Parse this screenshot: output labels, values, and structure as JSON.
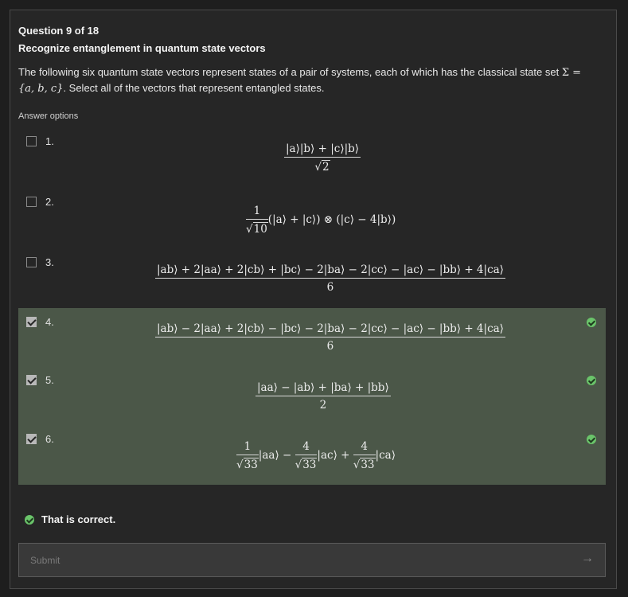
{
  "question": {
    "number_label": "Question 9 of 18",
    "title": "Recognize entanglement in quantum state vectors",
    "text_before_math": "The following six quantum state vectors represent states of a pair of systems, each of which has the classical state set ",
    "sigma": "Σ =",
    "set": "{a, b, c}",
    "text_after_math": ". Select all of the vectors that represent entangled states."
  },
  "answer_options_label": "Answer options",
  "options": [
    {
      "label": "1.",
      "checked": false,
      "correct_mark": false,
      "formula": "(|a⟩|b⟩ + |c⟩|b⟩) / √2"
    },
    {
      "label": "2.",
      "checked": false,
      "correct_mark": false,
      "formula": "1/√10 (|a⟩ + |c⟩) ⊗ (|c⟩ − 4|b⟩)"
    },
    {
      "label": "3.",
      "checked": false,
      "correct_mark": false,
      "formula": "(|ab⟩ + 2|aa⟩ + 2|cb⟩ + |bc⟩ − 2|ba⟩ − 2|cc⟩ − |ac⟩ − |bb⟩ + 4|ca⟩) / 6"
    },
    {
      "label": "4.",
      "checked": true,
      "correct_mark": true,
      "formula": "(|ab⟩ − 2|aa⟩ + 2|cb⟩ − |bc⟩ − 2|ba⟩ − 2|cc⟩ − |ac⟩ − |bb⟩ + 4|ca⟩) / 6"
    },
    {
      "label": "5.",
      "checked": true,
      "correct_mark": true,
      "formula": "(|aa⟩ − |ab⟩ + |ba⟩ + |bb⟩) / 2"
    },
    {
      "label": "6.",
      "checked": true,
      "correct_mark": true,
      "formula": "1/√33 |aa⟩ − 4/√33 |ac⟩ + 4/√33 |ca⟩"
    }
  ],
  "math": {
    "o1_num": "|a⟩|b⟩ + |c⟩|b⟩",
    "o1_den": "2",
    "o2_num": "1",
    "o2_den": "10",
    "o2_rest": "(|a⟩ + |c⟩) ⊗ (|c⟩ − 4|b⟩)",
    "o3_num": "|ab⟩ + 2|aa⟩ + 2|cb⟩ + |bc⟩ − 2|ba⟩ − 2|cc⟩ − |ac⟩ − |bb⟩ + 4|ca⟩",
    "o3_den": "6",
    "o4_num": "|ab⟩ − 2|aa⟩ + 2|cb⟩ − |bc⟩ − 2|ba⟩ − 2|cc⟩ − |ac⟩ − |bb⟩ + 4|ca⟩",
    "o4_den": "6",
    "o5_num": "|aa⟩ − |ab⟩ + |ba⟩ + |bb⟩",
    "o5_den": "2",
    "o6_n1": "1",
    "o6_d1": "33",
    "o6_t1": "|aa⟩ −",
    "o6_n2": "4",
    "o6_d2": "33",
    "o6_t2": "|ac⟩ +",
    "o6_n3": "4",
    "o6_d3": "33",
    "o6_t3": "|ca⟩"
  },
  "feedback": {
    "text": "That is correct.",
    "status_color": "#6ac46a"
  },
  "submit": {
    "label": "Submit",
    "arrow": "→"
  },
  "colors": {
    "background": "#1e1e1e",
    "panel": "#262626",
    "selected_row": "#4b5748",
    "success": "#6ac46a"
  }
}
